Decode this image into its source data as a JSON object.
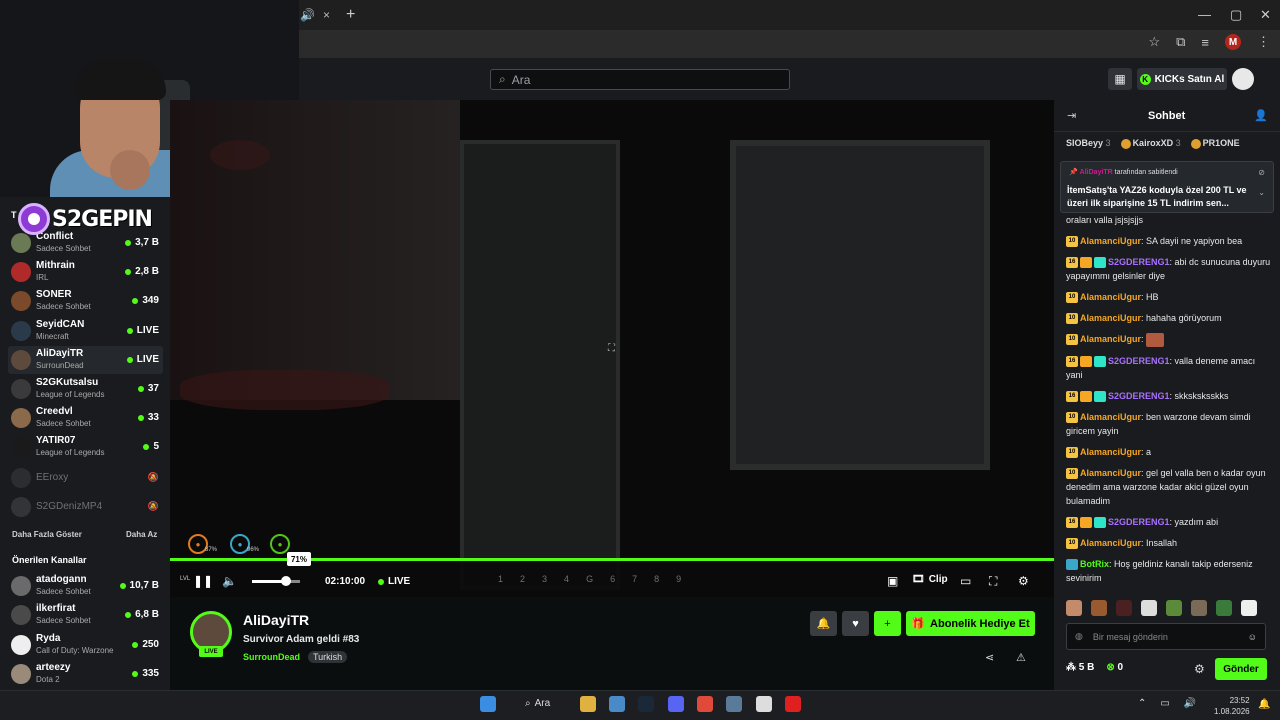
{
  "browser": {
    "new_tab_symbol": "+",
    "close_tab_symbol": "×"
  },
  "kick": {
    "search_placeholder": "Ara",
    "kicks_button": "KICKs Satın Al"
  },
  "sidebar": {
    "channels": [
      {
        "name": "Conflict",
        "sub": "Sadece Sohbet",
        "viewers": "3,7 B",
        "live_dot": true,
        "avatar": "#6a7a55"
      },
      {
        "name": "Mithrain",
        "sub": "IRL",
        "viewers": "2,8 B",
        "live_dot": true,
        "avatar": "#b12a2a"
      },
      {
        "name": "SONER",
        "sub": "Sadece Sohbet",
        "viewers": "349",
        "live_dot": true,
        "avatar": "#7a4a2a"
      },
      {
        "name": "SeyidCAN",
        "sub": "Minecraft",
        "viewers": "LIVE",
        "live_dot": true,
        "avatar": "#2a3a4a"
      },
      {
        "name": "AliDayiTR",
        "sub": "SurrounDead",
        "viewers": "LIVE",
        "live_dot": true,
        "avatar": "#5d4a3d",
        "active": true
      },
      {
        "name": "S2GKutsalsu",
        "sub": "League of Legends",
        "viewers": "37",
        "live_dot": true,
        "avatar": "#3a3a3a"
      },
      {
        "name": "Creedvl",
        "sub": "Sadece Sohbet",
        "viewers": "33",
        "live_dot": true,
        "avatar": "#8a6a4a"
      },
      {
        "name": "YATIR07",
        "sub": "League of Legends",
        "viewers": "5",
        "live_dot": true,
        "avatar": "#1a1a1a"
      }
    ],
    "offline": [
      {
        "name": "EEroxy",
        "avatar": "#444"
      },
      {
        "name": "S2GDenizMP4",
        "avatar": "#555"
      }
    ],
    "show_more": "Daha Fazla Göster",
    "show_less": "Daha Az",
    "recommended_heading": "Önerilen Kanallar",
    "recommended": [
      {
        "name": "atadogann",
        "sub": "Sadece Sohbet",
        "viewers": "10,7 B",
        "avatar": "#6a6a6a"
      },
      {
        "name": "ilkerfirat",
        "sub": "Sadece Sohbet",
        "viewers": "6,8 B",
        "avatar": "#4a4a4a"
      },
      {
        "name": "Ryda",
        "sub": "Call of Duty: Warzone",
        "viewers": "250",
        "avatar": "#eeeeee"
      },
      {
        "name": "arteezy",
        "sub": "Dota 2",
        "viewers": "335",
        "avatar": "#9a8a7a"
      }
    ]
  },
  "overlay": {
    "logo_text": "S2GEPIN",
    "sidebar_heading_prefix": "T"
  },
  "player": {
    "volume_tooltip": "71%",
    "volume_level": 0.71,
    "time": "02:10:00",
    "live_label": "LIVE",
    "slots": [
      "1",
      "2",
      "3",
      "4",
      "G",
      "6",
      "7",
      "8",
      "9"
    ],
    "hud": [
      {
        "label": "87%",
        "color": "#e07b20"
      },
      {
        "label": "96%",
        "color": "#3aa6c8"
      },
      {
        "label": "",
        "color": "#53c418"
      }
    ],
    "lvl_label": "LVL",
    "clip_label": "Clip"
  },
  "stream": {
    "streamer_name": "AliDayiTR",
    "title": "Survivor Adam geldi  #83",
    "category": "SurrounDead",
    "tag": "Turkish",
    "avatar_live_badge": "LIVE",
    "gift_button": "Abonelik Hediye Et"
  },
  "chat": {
    "title": "Sohbet",
    "gifters": [
      {
        "name": "SIOBeyy",
        "count": "3"
      },
      {
        "name": "KairoxXD",
        "count": "3"
      },
      {
        "name": "PR1ONE",
        "count": ""
      }
    ],
    "pinned_by_user": "AliDayiTR",
    "pinned_by_text": " tarafından sabitlendi",
    "pinned_message": "İtemSatış'ta YAZ26 koduyla özel 200 TL ve üzeri ilk siparişine 15 TL indirim sen...",
    "messages": [
      {
        "badges": [],
        "user": "",
        "color": "#e8e8e8",
        "text": "oraları valla jsjsjsjjs"
      },
      {
        "badges": [
          "10"
        ],
        "user": "AlamanciUgur",
        "color": "#f5a623",
        "text": "SA dayii ne yapiyon bea"
      },
      {
        "badges": [
          "16",
          "c",
          "t"
        ],
        "user": "S2GDERENG1",
        "color": "#a970ff",
        "text": "abi dc sunucuna duyuru yapayımmı gelsinler diye"
      },
      {
        "badges": [
          "10"
        ],
        "user": "AlamanciUgur",
        "color": "#f5a623",
        "text": "HB"
      },
      {
        "badges": [
          "10"
        ],
        "user": "AlamanciUgur",
        "color": "#f5a623",
        "text": "hahaha görüyorum"
      },
      {
        "badges": [
          "10"
        ],
        "user": "AlamanciUgur",
        "color": "#f5a623",
        "text": "",
        "emote": true
      },
      {
        "badges": [
          "16",
          "c",
          "t"
        ],
        "user": "S2GDERENG1",
        "color": "#a970ff",
        "text": "valla deneme amacı yani"
      },
      {
        "badges": [
          "16",
          "c",
          "t"
        ],
        "user": "S2GDERENG1",
        "color": "#a970ff",
        "text": "skksksksskks"
      },
      {
        "badges": [
          "10"
        ],
        "user": "AlamanciUgur",
        "color": "#f5a623",
        "text": "ben warzone devam simdi giricem yayin"
      },
      {
        "badges": [
          "10"
        ],
        "user": "AlamanciUgur",
        "color": "#f5a623",
        "text": "a"
      },
      {
        "badges": [
          "10"
        ],
        "user": "AlamanciUgur",
        "color": "#f5a623",
        "text": "gel gel valla ben o kadar oyun denedim ama warzone kadar akici güzel oyun bulamadim"
      },
      {
        "badges": [
          "16",
          "c",
          "t"
        ],
        "user": "S2GDERENG1",
        "color": "#a970ff",
        "text": "yazdım abi"
      },
      {
        "badges": [
          "10"
        ],
        "user": "AlamanciUgur",
        "color": "#f5a623",
        "text": "Insallah"
      },
      {
        "badges": [
          "bot"
        ],
        "user": "BotRix",
        "color": "#53fc18",
        "text": "Hoş geldiniz kanalı takip ederseniz sevinirim"
      }
    ],
    "input_placeholder": "Bir mesaj gönderin",
    "points": "5 B",
    "kicks": "0",
    "send_button": "Gönder"
  },
  "taskbar": {
    "search_label": "Ara",
    "time": "23:52",
    "date": "1.08.2026"
  }
}
